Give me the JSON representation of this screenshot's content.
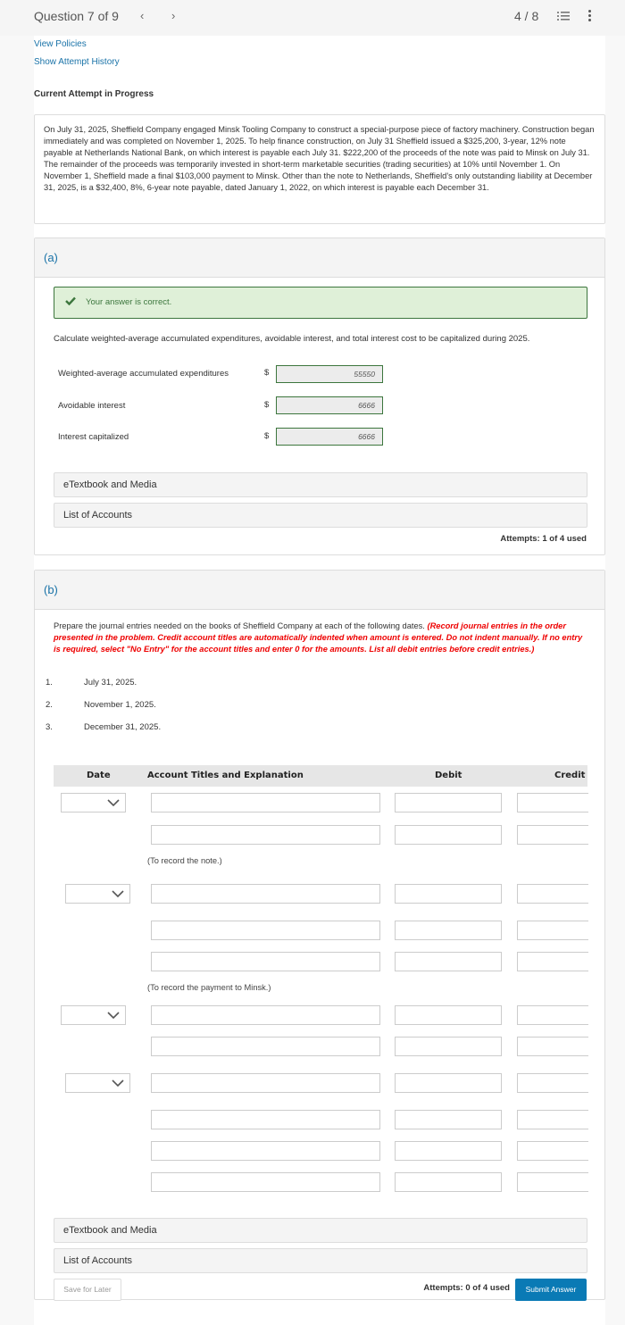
{
  "header": {
    "question_label": "Question 7 of 9",
    "prev_icon": "‹",
    "next_icon": "›",
    "progress": "4 / 8",
    "list_icon": "list-icon",
    "more_icon": "more-vertical-icon"
  },
  "links": {
    "view_policies": "View Policies",
    "show_attempt_history": "Show Attempt History"
  },
  "attempt_label": "Current Attempt in Progress",
  "problem_text": "On July 31, 2025, Sheffield Company engaged Minsk Tooling Company to construct a special-purpose piece of factory machinery. Construction began immediately and was completed on November 1, 2025. To help finance construction, on July 31 Sheffield issued a $325,200, 3-year, 12% note payable at Netherlands National Bank, on which interest is payable each July 31. $222,200 of the proceeds of the note was paid to Minsk on July 31. The remainder of the proceeds was temporarily invested in short-term marketable securities (trading securities) at 10% until November 1. On November 1, Sheffield made a final $103,000 payment to Minsk. Other than the note to Netherlands, Sheffield's only outstanding liability at December 31, 2025, is a $32,400, 8%, 6-year note payable, dated January 1, 2022, on which interest is payable each December 31.",
  "part_a": {
    "letter": "(a)",
    "feedback": "Your answer is correct.",
    "feedback_color": "#3c763d",
    "instruction": "Calculate weighted-average accumulated expenditures, avoidable interest, and total interest cost to be capitalized during 2025.",
    "rows": [
      {
        "label": "Weighted-average accumulated expenditures",
        "currency": "$",
        "value": "55550"
      },
      {
        "label": "Avoidable interest",
        "currency": "$",
        "value": "6666"
      },
      {
        "label": "Interest capitalized",
        "currency": "$",
        "value": "6666"
      }
    ],
    "etextbook": "eTextbook and Media",
    "list_of_accounts": "List of Accounts",
    "attempts": "Attempts: 1 of 4 used"
  },
  "part_b": {
    "letter": "(b)",
    "instruction_plain": "Prepare the journal entries needed on the books of Sheffield Company at each of the following dates. ",
    "instruction_red": "(Record journal entries in the order presented in the problem. Credit account titles are automatically indented when amount is entered. Do not indent manually. If no entry is required, select \"No Entry\" for the account titles and enter 0 for the amounts. List all debit entries before credit entries.)",
    "dates": [
      {
        "num": "1.",
        "text": "July 31, 2025."
      },
      {
        "num": "2.",
        "text": "November 1, 2025."
      },
      {
        "num": "3.",
        "text": "December 31, 2025."
      }
    ],
    "table_headers": {
      "date": "Date",
      "account": "Account Titles and Explanation",
      "debit": "Debit",
      "credit": "Credit"
    },
    "memos": [
      "(To record the note.)",
      "(To record the payment to Minsk.)"
    ],
    "etextbook": "eTextbook and Media",
    "list_of_accounts": "List of Accounts",
    "save_for_later": "Save for Later",
    "attempts": "Attempts: 0 of 4 used",
    "submit": "Submit Answer",
    "accent_color": "#0a7ab5"
  }
}
